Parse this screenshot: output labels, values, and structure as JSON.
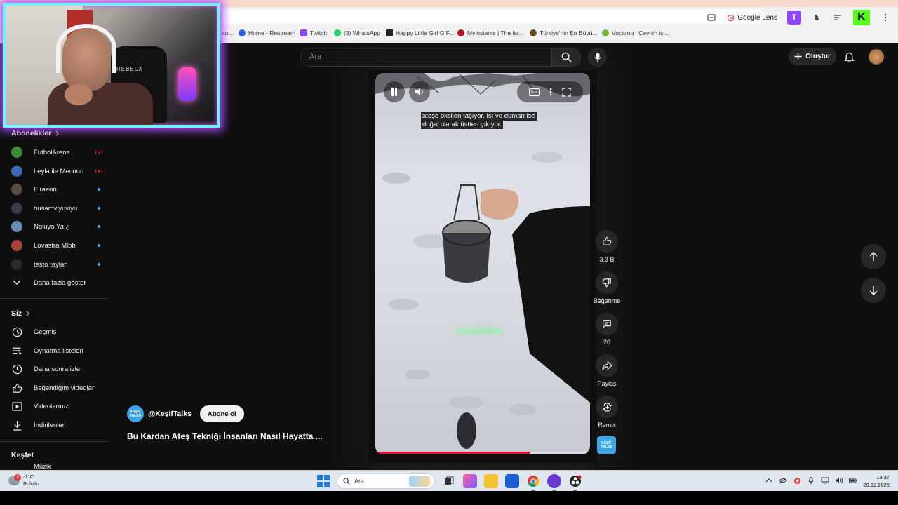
{
  "browser": {
    "google_chip_label": "Google Lens",
    "twitch_ext_label": "T",
    "kick_ext_label": "K",
    "bookmarks": [
      {
        "label": "an...",
        "color": "#888888"
      },
      {
        "label": "Home - Restream",
        "color": "#2b63d9"
      },
      {
        "label": "Twitch",
        "color": "#9146ff"
      },
      {
        "label": "(3) WhatsApp",
        "color": "#25d366"
      },
      {
        "label": "Happy Little Girl GIF...",
        "color": "#222222"
      },
      {
        "label": "Myinstants | The lar...",
        "color": "#b3121a"
      },
      {
        "label": "Türkiye'nin En Büyü...",
        "color": "#6b4d1f"
      },
      {
        "label": "Vocaroo | Çevrim içi...",
        "color": "#7cb342"
      }
    ]
  },
  "webcam": {
    "chair_brand": "REBELX"
  },
  "youtube": {
    "search": {
      "placeholder": "Ara"
    },
    "create_label": "Oluştur",
    "sidebar": {
      "subscriptions_heading": "Abonelikler",
      "subscriptions": [
        {
          "label": "FutbolArena",
          "color": "#3d8a3b",
          "status": "live"
        },
        {
          "label": "Leyla ile Mecnun",
          "color": "#3c6db2",
          "status": "live"
        },
        {
          "label": "Elraenn",
          "color": "#5a4a42",
          "status": "new"
        },
        {
          "label": "husamviyuviyu",
          "color": "#3a3a4a",
          "status": "new"
        },
        {
          "label": "Noluyo Ya ¿",
          "color": "#6a8bb0",
          "status": "new"
        },
        {
          "label": "Lovastra Mlbb",
          "color": "#a8443a",
          "status": "new"
        },
        {
          "label": "testo taylan",
          "color": "#2a2a2a",
          "status": "new"
        }
      ],
      "show_more_label": "Daha fazla göster",
      "you_heading": "Siz",
      "you_items": [
        {
          "label": "Geçmiş",
          "icon": "history-icon"
        },
        {
          "label": "Oynatma listeleri",
          "icon": "playlists-icon"
        },
        {
          "label": "Daha sonra izle",
          "icon": "watch-later-icon"
        },
        {
          "label": "Beğendiğim videolar",
          "icon": "liked-icon"
        },
        {
          "label": "Videolarınız",
          "icon": "your-videos-icon"
        },
        {
          "label": "İndirilenler",
          "icon": "downloads-icon"
        }
      ],
      "explore_heading": "Keşfet",
      "explore_partial": "Müzik"
    },
    "short": {
      "caption_line1": "ateşe oksijen taşıyor. Isı ve duman ise",
      "caption_line2": "doğal olarak üstten çıkıyor.",
      "watermark": "@KeşifTalks",
      "cc_label": "CC",
      "progress": 0.72,
      "channel_logo_text": "KEŞİF TALKS",
      "channel_name": "@KeşifTalks",
      "subscribe_label": "Abone ol",
      "title": "Bu Kardan Ateş Tekniği İnsanları Nasıl Hayatta ..."
    },
    "actions": {
      "like_count": "3,3 B",
      "dislike_label": "Beğenme",
      "comment_count": "20",
      "share_label": "Paylaş",
      "remix_label": "Remix"
    }
  },
  "taskbar": {
    "weather_badge": "3",
    "temperature": "-1°C",
    "condition": "Bulutlu",
    "search_label": "Ara",
    "time": "13:37",
    "date": "29.12.2025"
  }
}
